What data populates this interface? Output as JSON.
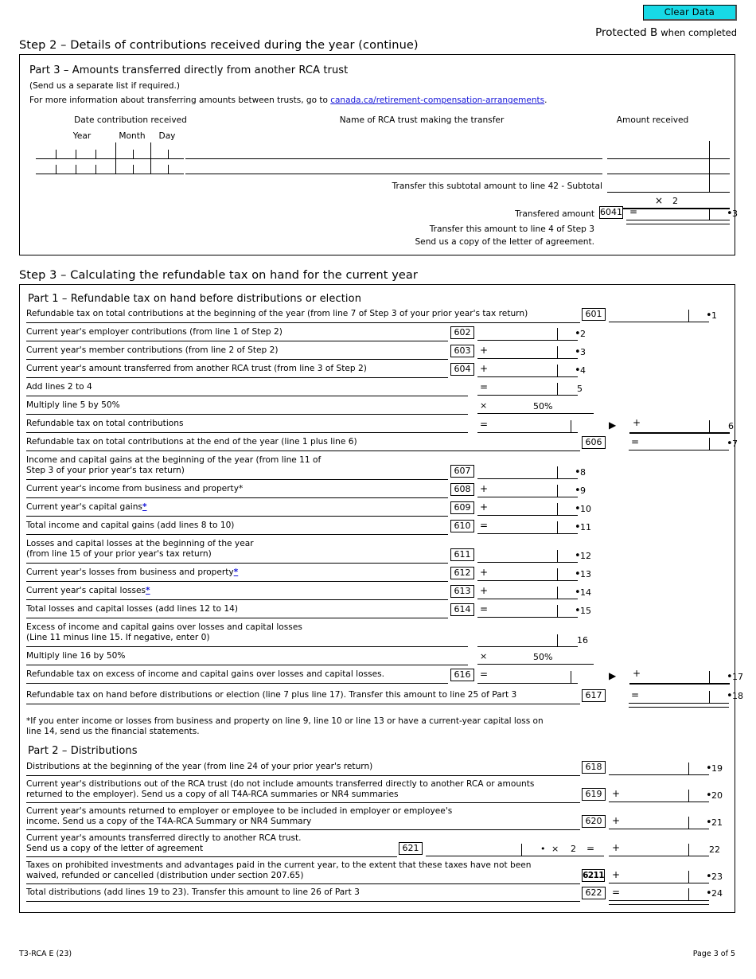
{
  "header": {
    "clear_data_label": "Clear Data",
    "protected_main": "Protected B",
    "protected_sub": "when completed"
  },
  "step2": {
    "title": "Step 2 – Details of contributions received during the year (continue)",
    "part3": {
      "title": "Part 3 – Amounts transferred directly from another RCA trust",
      "subnote": "(Send us a separate list if required.)",
      "info_prefix": "For more information about transferring amounts between trusts, go to ",
      "info_link": "canada.ca/retirement-compensation-arrangements",
      "info_suffix": ".",
      "col_date": "Date contribution received",
      "col_year": "Year",
      "col_month": "Month",
      "col_day": "Day",
      "col_name": "Name of RCA trust making the transfer",
      "col_amount": "Amount received",
      "subtotal_text": "Transfer this subtotal amount to line 42 - Subtotal",
      "multiplier_op": "×",
      "multiplier_value": "2",
      "transferred_label": "Transfered amount",
      "transferred_code": "6041",
      "transferred_op": "=",
      "transferred_line_no": "3",
      "footer_1": "Transfer this amount to line 4 of Step 3",
      "footer_2": "Send us a copy of the letter of agreement."
    }
  },
  "step3": {
    "title": "Step 3 – Calculating the refundable tax on hand for the current year",
    "part1": {
      "title": "Part 1 – Refundable tax on hand before distributions or election",
      "rows": [
        {
          "label": "Refundable tax on total contributions at the beginning of the year (from line 7 of Step 3 of your prior year's tax return)",
          "code": "601",
          "op": "",
          "line_no": "1",
          "dot": true
        },
        {
          "label": "Current year's employer contributions (from line 1 of Step 2)",
          "code": "602",
          "op": "",
          "line_no": "2",
          "dot": true
        },
        {
          "label": "Current year's member contributions (from line 2 of Step 2)",
          "code": "603",
          "op": "+",
          "line_no": "3",
          "dot": true
        },
        {
          "label": "Current year's amount transferred from another RCA trust (from line 3 of Step 2)",
          "code": "604",
          "op": "+",
          "line_no": "4",
          "dot": true
        },
        {
          "label": "Add lines 2 to 4",
          "code": "",
          "op": "=",
          "line_no": "5",
          "dot": false
        },
        {
          "label": "Multiply line 5 by 50%",
          "code": "",
          "op": "×",
          "pct": "50%",
          "line_no": "",
          "dot": false
        },
        {
          "label": "Refundable tax on total contributions",
          "code": "",
          "op": "=",
          "line_no": "6",
          "dot": false
        },
        {
          "label": "Refundable tax on total contributions at the end of the year (line 1 plus line 6)",
          "code": "606",
          "op": "=",
          "line_no": "7",
          "dot": true
        },
        {
          "label": "Income and capital gains at the beginning of the year (from line 11 of\nStep 3 of your prior year's tax return)",
          "code": "607",
          "op": "",
          "line_no": "8",
          "dot": true
        },
        {
          "label": "Current year's income from business and property*",
          "code": "608",
          "op": "+",
          "line_no": "9",
          "dot": true
        },
        {
          "label": "Current year's capital gains*",
          "code": "609",
          "op": "+",
          "line_no": "10",
          "dot": true
        },
        {
          "label": "Total income and capital gains (add lines 8 to 10)",
          "code": "610",
          "op": "=",
          "line_no": "11",
          "dot": true
        },
        {
          "label": "Losses and capital losses at the beginning of the year\n(from line 15 of your prior year's tax return)",
          "code": "611",
          "op": "",
          "line_no": "12",
          "dot": true
        },
        {
          "label": "Current year's losses from business and property*",
          "code": "612",
          "op": "+",
          "line_no": "13",
          "dot": true
        },
        {
          "label": "Current year's capital losses*",
          "code": "613",
          "op": "+",
          "line_no": "14",
          "dot": true
        },
        {
          "label": "Total losses and capital losses (add lines 12 to 14)",
          "code": "614",
          "op": "=",
          "line_no": "15",
          "dot": true
        },
        {
          "label": "Excess of income and capital gains over losses and capital losses\n(Line 11 minus line 15. If negative, enter 0)",
          "code": "",
          "op": "",
          "line_no": "16",
          "dot": false
        },
        {
          "label": "Multiply line 16 by 50%",
          "code": "",
          "op": "×",
          "pct": "50%",
          "line_no": "",
          "dot": false
        },
        {
          "label": "Refundable tax on excess of income and capital gains over losses and capital losses.",
          "code": "616",
          "op": "=",
          "line_no": "17",
          "dot": true
        },
        {
          "label": "Refundable tax on hand before distributions or election (line 7 plus line 17). Transfer this amount to line 25 of Part 3",
          "code": "617",
          "op": "=",
          "line_no": "18",
          "dot": true
        }
      ],
      "footnote": "*If you enter income or losses from business and property on line 9, line 10 or line 13 or have a current-year capital loss on\n  line 14, send us the financial statements."
    },
    "part2": {
      "title": "Part 2 – Distributions",
      "rows": [
        {
          "label": "Distributions at the beginning of the year (from line 24 of your prior year's return)",
          "code": "618",
          "op": "",
          "line_no": "19",
          "dot": true
        },
        {
          "label": "Current year's distributions out of the RCA trust (do not include amounts transferred directly to another RCA or amounts\nreturned to the employer). Send us a copy of all T4A-RCA summaries or NR4 summaries",
          "code": "619",
          "op": "+",
          "line_no": "20",
          "dot": true
        },
        {
          "label": "Current year's amounts returned to employer or employee to be included in employer or employee's\nincome. Send us a copy of the T4A-RCA Summary or NR4 Summary",
          "code": "620",
          "op": "+",
          "line_no": "21",
          "dot": true
        },
        {
          "label": "Current year's amounts transferred directly to another RCA trust.\nSend us a copy of the letter of agreement",
          "code": "621",
          "op": "+",
          "line_no": "22",
          "dot": false,
          "mult_op": "×",
          "mult_val": "2",
          "mult_eq": "="
        },
        {
          "label": "Taxes on prohibited investments and advantages paid in the current year, to the extent that these taxes have not been\nwaived, refunded or cancelled (distribution under section 207.65)",
          "code": "6211",
          "op": "+",
          "line_no": "23",
          "dot": true
        },
        {
          "label": "Total distributions (add lines 19 to 23). Transfer this amount to line 26 of Part 3",
          "code": "622",
          "op": "=",
          "line_no": "24",
          "dot": true
        }
      ]
    }
  },
  "footer": {
    "form_code": "T3-RCA E (23)",
    "page_label": "Page 3 of 5"
  },
  "colors": {
    "clear_data_bg": "#17d9e6",
    "link": "#1414d8"
  }
}
